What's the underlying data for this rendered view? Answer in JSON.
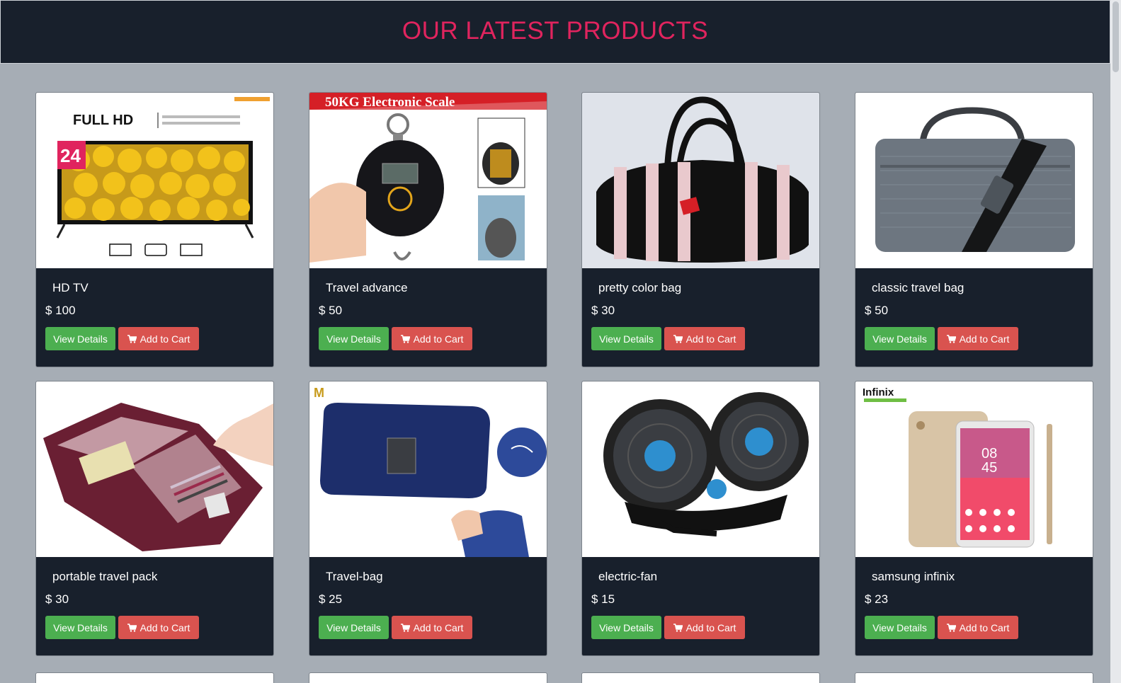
{
  "header": {
    "title": "OUR LATEST PRODUCTS"
  },
  "colors": {
    "header_bg": "#18202c",
    "title": "#e0245e",
    "view_btn": "#4caf50",
    "cart_btn": "#d9534f",
    "page_bg": "#a6adb5"
  },
  "products": [
    {
      "name": "HD TV",
      "price": "$ 100",
      "view_label": "View Details",
      "cart_label": "Add to Cart",
      "image": "tv-image",
      "img_text": "FULL HD",
      "img_badge": "24"
    },
    {
      "name": "Travel advance",
      "price": "$ 50",
      "view_label": "View Details",
      "cart_label": "Add to Cart",
      "image": "scale-image",
      "img_text": "50KG Electronic Scale"
    },
    {
      "name": "pretty color bag",
      "price": "$ 30",
      "view_label": "View Details",
      "cart_label": "Add to Cart",
      "image": "striped-bag-image"
    },
    {
      "name": "classic travel bag",
      "price": "$ 50",
      "view_label": "View Details",
      "cart_label": "Add to Cart",
      "image": "laptop-bag-image"
    },
    {
      "name": "portable travel pack",
      "price": "$ 30",
      "view_label": "View Details",
      "cart_label": "Add to Cart",
      "image": "travel-pack-image"
    },
    {
      "name": "Travel-bag",
      "price": "$ 25",
      "view_label": "View Details",
      "cart_label": "Add to Cart",
      "image": "pouch-image"
    },
    {
      "name": "electric-fan",
      "price": "$ 15",
      "view_label": "View Details",
      "cart_label": "Add to Cart",
      "image": "fan-image"
    },
    {
      "name": "samsung infinix",
      "price": "$ 23",
      "view_label": "View Details",
      "cart_label": "Add to Cart",
      "image": "phone-image",
      "img_text": "Infinix"
    }
  ]
}
